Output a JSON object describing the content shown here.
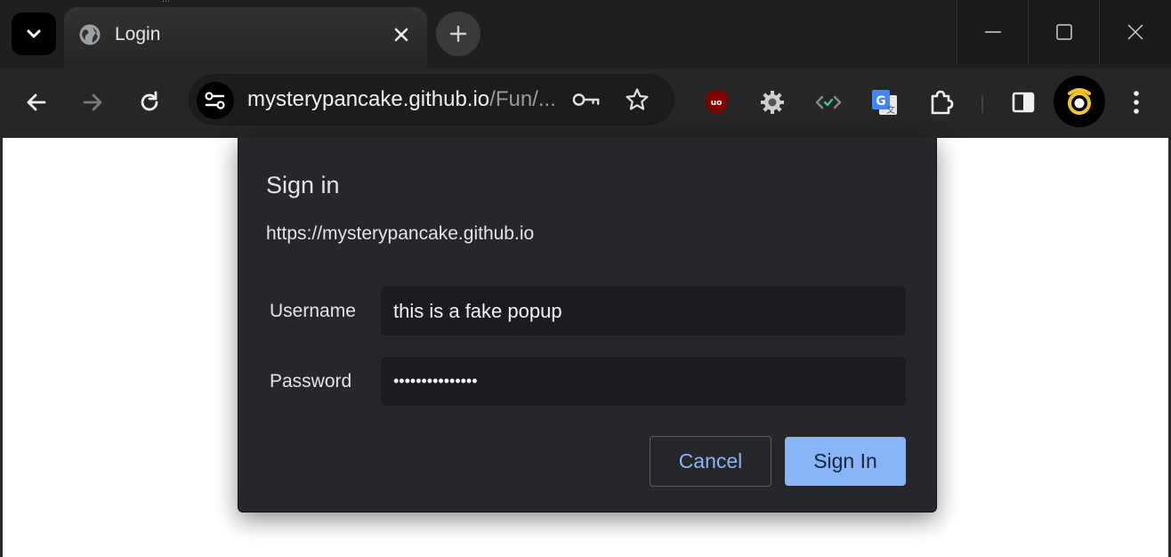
{
  "browser": {
    "tab_title": "Login",
    "scroll_text": "...",
    "url_host": "mysterypancake.github.io",
    "url_path": "/Fun/..."
  },
  "icons": {
    "tab_search": "chevron-down-icon",
    "favicon": "globe-icon",
    "tab_close": "close-icon",
    "new_tab": "plus-icon",
    "minimize": "minimize-icon",
    "maximize": "maximize-icon",
    "window_close": "close-icon",
    "back": "arrow-left-icon",
    "forward": "arrow-right-icon",
    "reload": "reload-icon",
    "site_info": "tune-icon",
    "password_key": "key-icon",
    "bookmark": "star-icon",
    "extensions": [
      "ublock-icon",
      "gear-icon",
      "code-icon",
      "translate-icon",
      "puzzle-icon"
    ],
    "side_panel": "side-panel-icon",
    "profile": "profile-avatar-icon",
    "menu": "kebab-menu-icon"
  },
  "dialog": {
    "title": "Sign in",
    "origin": "https://mysterypancake.github.io",
    "username_label": "Username",
    "username_value": "this is a fake popup",
    "password_label": "Password",
    "password_value": "•••••••••••••••",
    "cancel_label": "Cancel",
    "signin_label": "Sign In"
  },
  "colors": {
    "dialog_bg": "#26272b",
    "field_bg": "#1b1c1f",
    "accent": "#8ab4f8",
    "page_bg": "#ffffff"
  }
}
